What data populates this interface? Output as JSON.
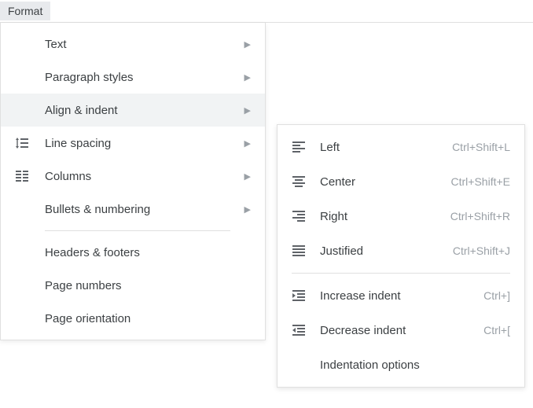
{
  "menubar": {
    "format": "Format"
  },
  "menu": {
    "text": "Text",
    "paragraph_styles": "Paragraph styles",
    "align_indent": "Align & indent",
    "line_spacing": "Line spacing",
    "columns": "Columns",
    "bullets_numbering": "Bullets & numbering",
    "headers_footers": "Headers & footers",
    "page_numbers": "Page numbers",
    "page_orientation": "Page orientation"
  },
  "submenu": {
    "left": {
      "label": "Left",
      "shortcut": "Ctrl+Shift+L"
    },
    "center": {
      "label": "Center",
      "shortcut": "Ctrl+Shift+E"
    },
    "right": {
      "label": "Right",
      "shortcut": "Ctrl+Shift+R"
    },
    "justified": {
      "label": "Justified",
      "shortcut": "Ctrl+Shift+J"
    },
    "increase_indent": {
      "label": "Increase indent",
      "shortcut": "Ctrl+]"
    },
    "decrease_indent": {
      "label": "Decrease indent",
      "shortcut": "Ctrl+["
    },
    "indentation_options": {
      "label": "Indentation options"
    }
  }
}
